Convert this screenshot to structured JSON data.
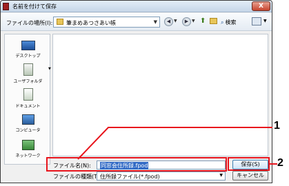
{
  "window": {
    "title": "名前を付けて保存",
    "close_label": "X"
  },
  "navbar": {
    "lookin_label": "ファイルの場所(I):",
    "lookin_value": "筆まめあつさあい帳",
    "search_label": "検索",
    "back_icon": "back-arrow-icon",
    "forward_icon": "forward-arrow-icon"
  },
  "places": [
    {
      "label": "デスクトップ",
      "icon": "desktop-icon"
    },
    {
      "label": "ユーザフォルダ",
      "icon": "user-folder-icon"
    },
    {
      "label": "ドキュメント",
      "icon": "documents-icon"
    },
    {
      "label": "コンピュータ",
      "icon": "computer-icon"
    },
    {
      "label": "ネットワーク",
      "icon": "network-icon"
    }
  ],
  "filename": {
    "label": "ファイル名(N):",
    "value": "同窓会住所録.fpod"
  },
  "filetype": {
    "label": "ファイルの種類(T):",
    "value": "住所録ファイル(*.fpod)"
  },
  "buttons": {
    "save": "保存(S)",
    "cancel": "キャンセル"
  },
  "callouts": {
    "one": "1",
    "two": "2"
  },
  "colors": {
    "highlight": "#e8141c",
    "titlebar": "#c5d6e8"
  }
}
